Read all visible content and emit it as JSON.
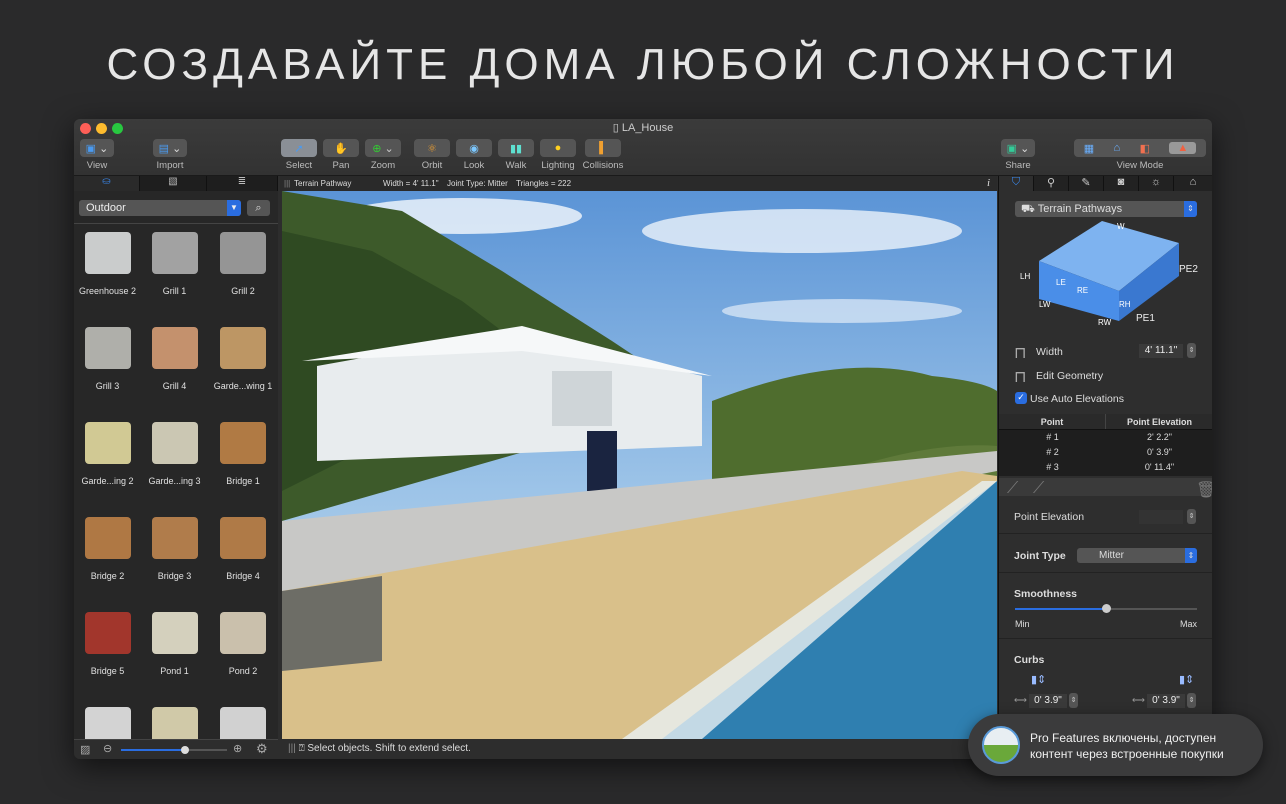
{
  "headline": "СОЗДАВАЙТЕ ДОМА ЛЮБОЙ СЛОЖНОСТИ",
  "window": {
    "title": "LA_House"
  },
  "toolbar": {
    "view": "View",
    "import": "Import",
    "select": "Select",
    "pan": "Pan",
    "zoom": "Zoom",
    "orbit": "Orbit",
    "look": "Look",
    "walk": "Walk",
    "lighting": "Lighting",
    "collisions": "Collisions",
    "share": "Share",
    "view_mode": "View Mode"
  },
  "library": {
    "category": "Outdoor",
    "items": [
      {
        "label": "Greenhouse 2",
        "color": "#e8eaea"
      },
      {
        "label": "Grill 1",
        "color": "#b8b8b8"
      },
      {
        "label": "Grill 2",
        "color": "#a9a9a9"
      },
      {
        "label": "Grill 3",
        "color": "#c8c8c2"
      },
      {
        "label": "Grill 4",
        "color": "#e0a47a"
      },
      {
        "label": "Garde...wing 1",
        "color": "#d8aa70"
      },
      {
        "label": "Garde...ing 2",
        "color": "#f0e6a8"
      },
      {
        "label": "Garde...ing 3",
        "color": "#e9e4cc"
      },
      {
        "label": "Bridge 1",
        "color": "#c98a4a"
      },
      {
        "label": "Bridge 2",
        "color": "#c8874a"
      },
      {
        "label": "Bridge 3",
        "color": "#c98c52"
      },
      {
        "label": "Bridge 4",
        "color": "#c88a4e"
      },
      {
        "label": "Bridge 5",
        "color": "#b83a2e"
      },
      {
        "label": "Pond 1",
        "color": "#f3eed8"
      },
      {
        "label": "Pond 2",
        "color": "#e8dcc4"
      },
      {
        "label": "",
        "color": "#f2f2f2"
      },
      {
        "label": "",
        "color": "#efe6c0"
      },
      {
        "label": "",
        "color": "#f0f0f0"
      }
    ],
    "zoom_level": 0.6
  },
  "infobar": {
    "object": "Terrain Pathway",
    "width": "Width = 4' 11.1\"",
    "joint": "Joint Type: Mitter",
    "triangles": "Triangles = 222",
    "info_icon": "i"
  },
  "status": {
    "text": "Select objects. Shift to extend select."
  },
  "inspector": {
    "type": "Terrain Pathways",
    "diagram": {
      "w": "W",
      "lh": "LH",
      "le": "LE",
      "re": "RE",
      "rh": "RH",
      "lw": "LW",
      "rw": "RW",
      "pe1": "PE1",
      "pe2": "PE2"
    },
    "width_label": "Width",
    "width_value": "4' 11.1\"",
    "edit_geometry": "Edit Geometry",
    "auto_elev": "Use Auto Elevations",
    "auto_elev_checked": true,
    "table": {
      "headers": [
        "Point",
        "Point Elevation"
      ],
      "rows": [
        [
          "# 1",
          "2' 2.2\""
        ],
        [
          "# 2",
          "0' 3.9\""
        ],
        [
          "# 3",
          "0' 11.4\""
        ]
      ]
    },
    "point_elev_label": "Point Elevation",
    "joint_label": "Joint Type",
    "joint_value": "Mitter",
    "smooth_label": "Smoothness",
    "smooth_min": "Min",
    "smooth_max": "Max",
    "smooth_value": 0.5,
    "curbs_label": "Curbs",
    "curb_left": "0' 3.9\"",
    "curb_right": "0' 3.9\""
  },
  "toast": {
    "line1": "Pro Features включены, доступен",
    "line2": "контент через встроенные покупки"
  },
  "colors": {
    "accent": "#2a6de0",
    "bg": "#2a2a2b"
  }
}
